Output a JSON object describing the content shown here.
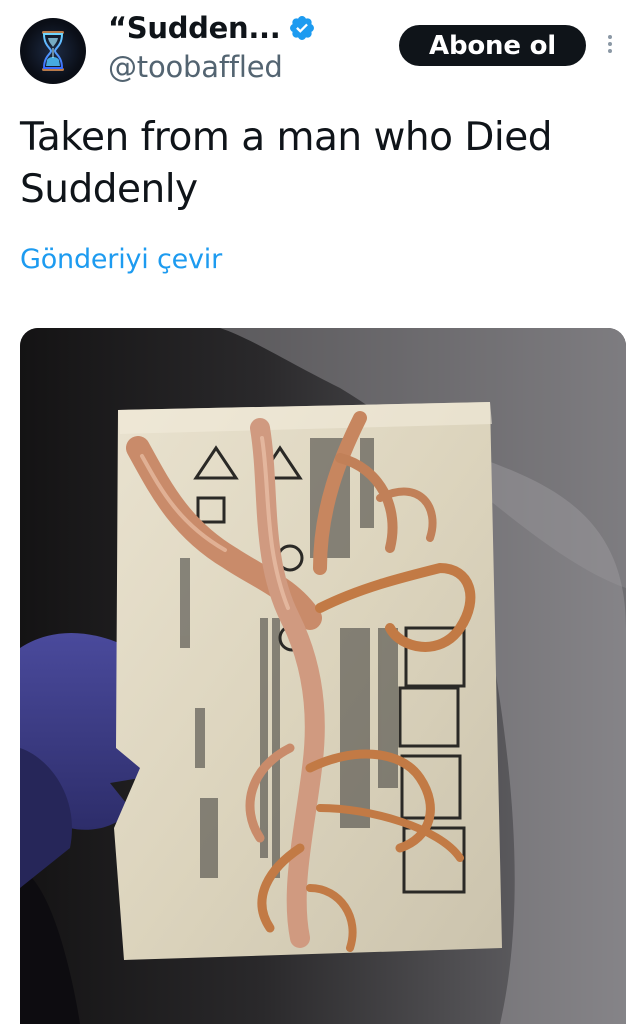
{
  "tweet": {
    "author": {
      "display_name": "“Sudden...",
      "handle": "@toobaffled",
      "verified": true,
      "avatar_icon": "hourglass-icon"
    },
    "subscribe_label": "Abone ol",
    "more_icon": "more-vertical-icon",
    "text": "Taken from a man who Died Suddenly",
    "translate_label": "Gönderiyi çevir",
    "media": {
      "type": "photo"
    }
  },
  "colors": {
    "text_primary": "#0f1419",
    "text_secondary": "#536471",
    "link": "#1d9bf0",
    "verified": "#1d9bf0",
    "button_bg": "#0f1419",
    "button_text": "#ffffff"
  }
}
